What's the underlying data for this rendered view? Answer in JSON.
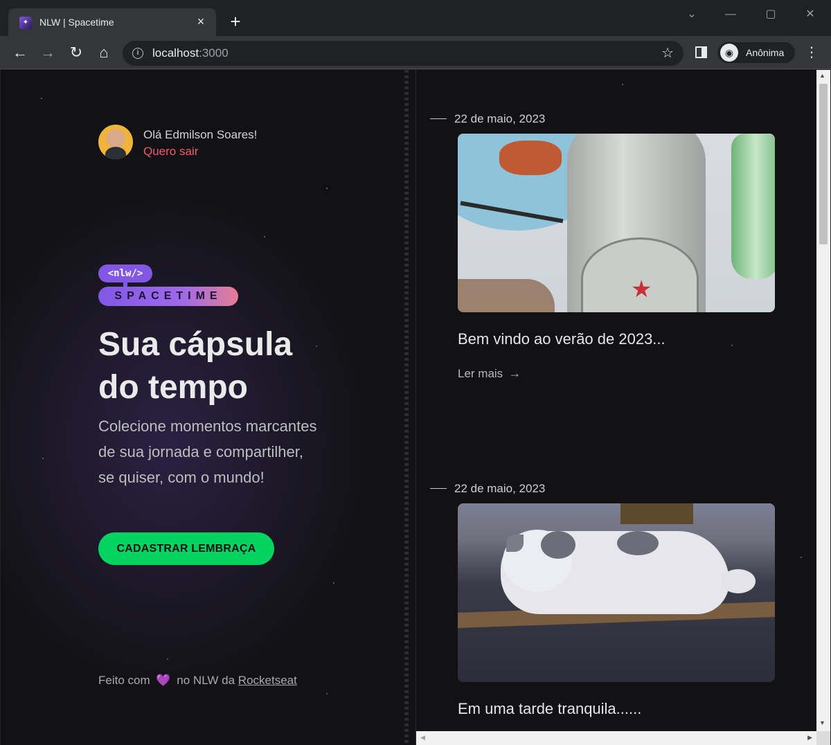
{
  "browser": {
    "tab_title": "NLW | Spacetime",
    "new_tab_label": "+",
    "url_host": "localhost",
    "url_port": ":3000",
    "profile_label": "Anônima"
  },
  "user": {
    "greeting": "Olá Edmilson Soares!",
    "logout_label": "Quero sair"
  },
  "logo": {
    "top": "<nlw/>",
    "bottom": "SPACETIME"
  },
  "hero": {
    "headline": "Sua cápsula do tempo",
    "lead": "Colecione momentos marcantes de sua jornada e compartilher, se quiser, com o mundo!",
    "cta_label": "CADASTRAR LEMBRAÇA"
  },
  "footer": {
    "prefix": "Feito com",
    "middle": "no NLW da",
    "link": "Rocketseat"
  },
  "memories": [
    {
      "date": "22 de maio, 2023",
      "caption": "Bem vindo ao verão de 2023...",
      "read_more": "Ler mais"
    },
    {
      "date": "22 de maio, 2023",
      "caption": "Em uma tarde tranquila......"
    }
  ],
  "colors": {
    "accent_green": "#04d361",
    "accent_purple": "#8257e5",
    "logout_red": "#ef5a6f",
    "background": "#121215"
  },
  "icons": [
    "back-icon",
    "forward-icon",
    "reload-icon",
    "home-icon",
    "info-icon",
    "star-icon",
    "side-panel-icon",
    "incognito-icon",
    "menu-icon",
    "heart-icon",
    "arrow-right-icon"
  ]
}
